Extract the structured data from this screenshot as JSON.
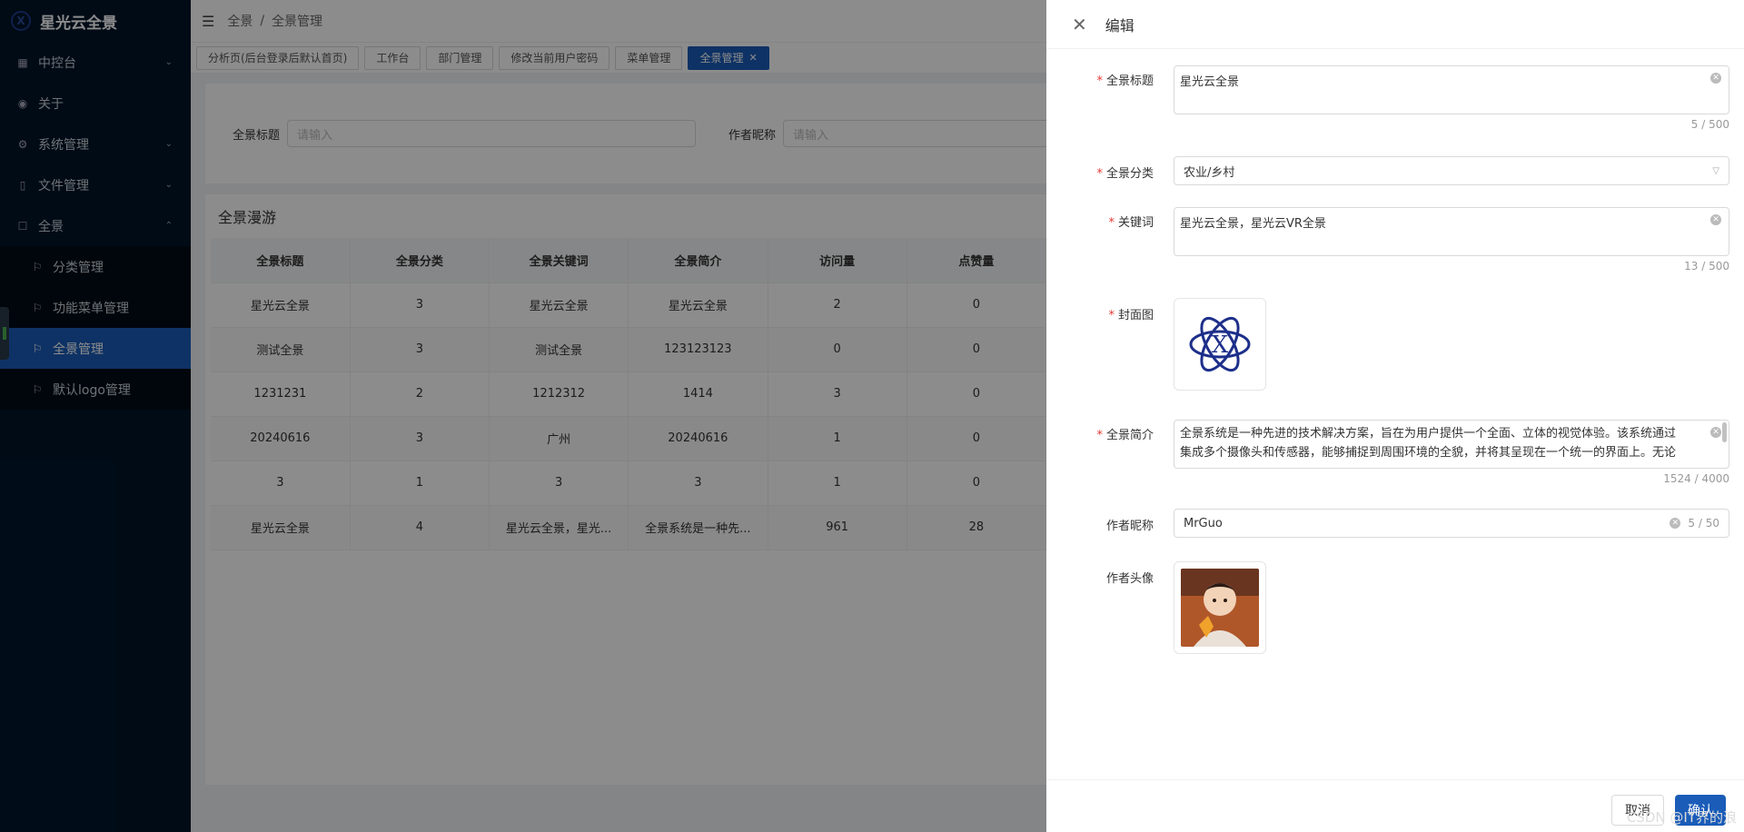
{
  "app": {
    "title": "星光云全景"
  },
  "sidebar": {
    "items": [
      {
        "label": "中控台",
        "icon": "grid-icon",
        "chevron": "⌄"
      },
      {
        "label": "关于",
        "icon": "eye-icon"
      },
      {
        "label": "系统管理",
        "icon": "gear-icon",
        "chevron": "⌄"
      },
      {
        "label": "文件管理",
        "icon": "file-icon",
        "chevron": "⌄"
      },
      {
        "label": "全景",
        "icon": "square-icon",
        "chevron": "⌃"
      }
    ],
    "sub": [
      {
        "label": "分类管理"
      },
      {
        "label": "功能菜单管理"
      },
      {
        "label": "全景管理"
      },
      {
        "label": "默认logo管理"
      }
    ]
  },
  "topbar": {
    "crumb": [
      "全景",
      "/",
      "全景管理"
    ]
  },
  "tabs": [
    "分析页(后台登录后默认首页)",
    "工作台",
    "部门管理",
    "修改当前用户密码",
    "菜单管理",
    "全景管理"
  ],
  "filter": {
    "title_label": "全景标题",
    "title_placeholder": "请输入",
    "author_label": "作者昵称",
    "author_placeholder": "请输入"
  },
  "table": {
    "card_title": "全景漫游",
    "headers": [
      "全景标题",
      "全景分类",
      "全景关键词",
      "全景简介",
      "访问量",
      "点赞量"
    ],
    "rows": [
      [
        "星光云全景",
        "3",
        "星光云全景",
        "星光云全景",
        "2",
        "0"
      ],
      [
        "测试全景",
        "3",
        "测试全景",
        "123123123",
        "0",
        "0"
      ],
      [
        "1231231",
        "2",
        "1212312",
        "1414",
        "3",
        "0"
      ],
      [
        "20240616",
        "3",
        "广州",
        "20240616",
        "1",
        "0"
      ],
      [
        "3",
        "1",
        "3",
        "3",
        "1",
        "0"
      ],
      [
        "星光云全景",
        "4",
        "星光云全景，星光...",
        "全景系统是一种先...",
        "961",
        "28"
      ]
    ]
  },
  "drawer": {
    "title": "编辑",
    "fields": {
      "title_label": "全景标题",
      "title_value": "星光云全景",
      "title_count": "5 / 500",
      "category_label": "全景分类",
      "category_value": "农业/乡村",
      "keywords_label": "关键词",
      "keywords_value": "星光云全景，星光云VR全景",
      "keywords_count": "13 / 500",
      "cover_label": "封面图",
      "intro_label": "全景简介",
      "intro_value": "全景系统是一种先进的技术解决方案，旨在为用户提供一个全面、立体的视觉体验。该系统通过集成多个摄像头和传感器，能够捕捉到周围环境的全貌，并将其呈现在一个统一的界面上。无论",
      "intro_count": "1524 / 4000",
      "author_label": "作者昵称",
      "author_value": "MrGuo",
      "author_count": "5 / 50",
      "avatar_label": "作者头像"
    },
    "cancel": "取消",
    "confirm": "确认"
  },
  "watermark": "CSDN @IT界的浪"
}
